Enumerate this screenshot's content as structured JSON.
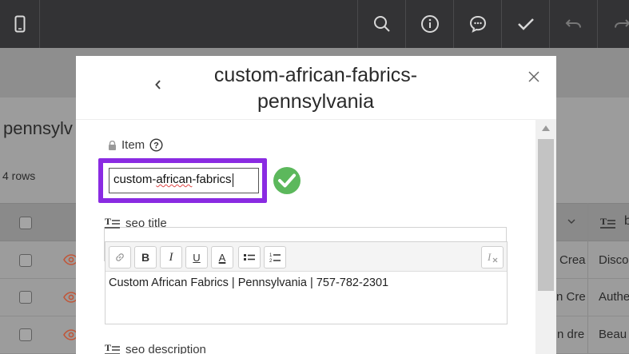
{
  "toolbar": {
    "icons": [
      "mobile-icon",
      "search-icon",
      "info-icon",
      "comment-icon",
      "check-icon",
      "undo-icon",
      "redo-icon"
    ]
  },
  "background": {
    "page_title": "pennsylv",
    "row_count": "4 rows",
    "header_letter": "b",
    "rows": [
      {
        "col1": "Crea",
        "col2": "Disco"
      },
      {
        "col1": "n Cre",
        "col2": "Authe"
      },
      {
        "col1": "n dre",
        "col2": "Beau"
      }
    ]
  },
  "modal": {
    "title": "custom-african-fabrics-pennsylvania",
    "item_label": "Item",
    "item_value_prefix": "custom-",
    "item_value_misspelled": "african",
    "item_value_suffix": "-fabrics",
    "seo_title_label": "seo title",
    "seo_title_value": "Custom African Fabrics | Pennsylvania | 757-782-2301",
    "seo_description_label": "seo description",
    "editor_buttons": {
      "bold": "B",
      "italic": "I",
      "underline": "U",
      "font_color": "A"
    }
  },
  "colors": {
    "highlight": "#8a2be2",
    "success": "#5cb85c",
    "eye_icon": "#c0573a",
    "topbar": "#333335"
  }
}
